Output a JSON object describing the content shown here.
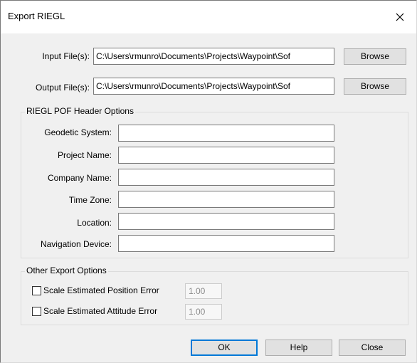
{
  "window": {
    "title": "Export RIEGL",
    "close_icon": "close-icon"
  },
  "files": {
    "input_label": "Input File(s):",
    "input_value": "C:\\Users\\rmunro\\Documents\\Projects\\Waypoint\\Sof",
    "output_label": "Output File(s):",
    "output_value": "C:\\Users\\rmunro\\Documents\\Projects\\Waypoint\\Sof",
    "browse_label": "Browse"
  },
  "header_options": {
    "title": "RIEGL POF Header Options",
    "fields": [
      {
        "label": "Geodetic System:",
        "value": ""
      },
      {
        "label": "Project Name:",
        "value": ""
      },
      {
        "label": "Company Name:",
        "value": ""
      },
      {
        "label": "Time Zone:",
        "value": ""
      },
      {
        "label": "Location:",
        "value": ""
      },
      {
        "label": "Navigation Device:",
        "value": ""
      }
    ]
  },
  "other_options": {
    "title": "Other Export Options",
    "position_label": "Scale Estimated Position Error",
    "position_checked": false,
    "position_value": "1.00",
    "attitude_label": "Scale Estimated Attitude Error",
    "attitude_checked": false,
    "attitude_value": "1.00"
  },
  "buttons": {
    "ok": "OK",
    "help": "Help",
    "close": "Close"
  }
}
